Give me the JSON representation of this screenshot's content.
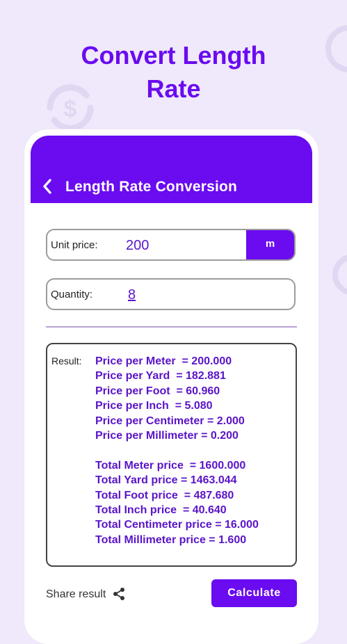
{
  "hero": {
    "title_line1": "Convert Length",
    "title_line2": "Rate"
  },
  "colors": {
    "accent": "#6a0bf0",
    "background": "#efe9fb",
    "result_text": "#5a14c8"
  },
  "appbar": {
    "back_icon": "chevron-left-icon",
    "title": "Length Rate Conversion"
  },
  "unit_price": {
    "label": "Unit price:",
    "value": "200",
    "unit_button": "m"
  },
  "quantity": {
    "label": "Quantity:",
    "value": "8"
  },
  "result": {
    "label": "Result:",
    "per_unit": [
      "Price per Meter  = 200.000",
      "Price per Yard  = 182.881",
      "Price per Foot  = 60.960",
      "Price per Inch  = 5.080",
      "Price per Centimeter = 2.000",
      "Price per Millimeter = 0.200"
    ],
    "totals": [
      "Total Meter price  = 1600.000",
      "Total Yard price = 1463.044",
      "Total Foot price  = 487.680",
      "Total Inch price  = 40.640",
      "Total Centimeter price = 16.000",
      "Total Millimeter price = 1.600"
    ]
  },
  "footer": {
    "share_label": "Share result",
    "share_icon": "share-icon",
    "calculate_label": "Calculate"
  }
}
